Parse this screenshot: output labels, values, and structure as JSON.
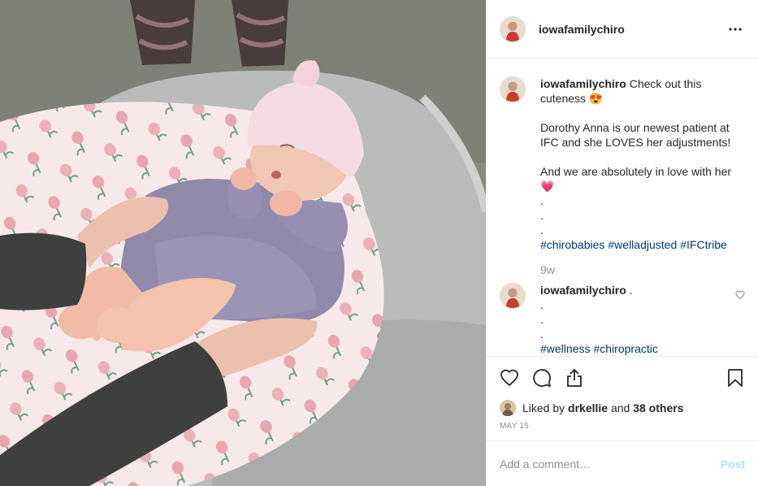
{
  "post": {
    "username": "iowafamilychiro"
  },
  "caption": {
    "username": "iowafamilychiro",
    "line1": "Check out this cuteness 😍",
    "line2": "Dorothy Anna is our newest patient at IFC and she LOVES her adjustments!",
    "line3": "And we are absolutely in love with her 💗",
    "dot1": ".",
    "dot2": ".",
    "dot3": ".",
    "hashtags": [
      "#chirobabies",
      "#welladjusted",
      "#IFCtribe"
    ]
  },
  "time_ago": "9w",
  "comment2": {
    "username": "iowafamilychiro",
    "text": ".",
    "dot1": ".",
    "dot2": ".",
    "hashtags": [
      "#wellness",
      "#chiropractic"
    ]
  },
  "likes": {
    "prefix": "Liked by ",
    "first_liker": "drkellie",
    "middle": " and ",
    "others": "38 others"
  },
  "date": "MAY 15",
  "add_comment": {
    "placeholder": "Add a comment…",
    "post_label": "Post"
  },
  "icons": {
    "more": "more-horizontal-icon",
    "like": "heart-icon",
    "comment": "comment-bubble-icon",
    "share": "share-icon",
    "save": "bookmark-icon",
    "comment_like": "small-heart-icon"
  },
  "colors": {
    "hashtag": "#00376b",
    "muted": "#8e8e8e",
    "post_button_disabled": "#b2dffc",
    "text": "#262626",
    "border": "#efefef"
  }
}
